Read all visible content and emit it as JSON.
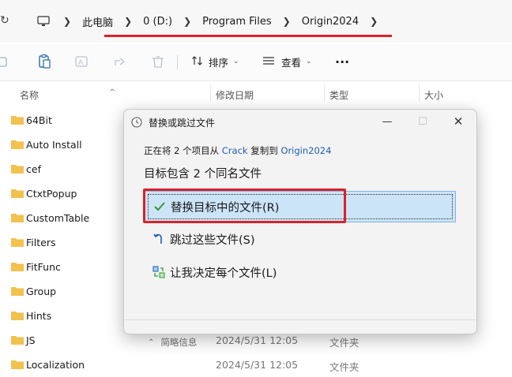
{
  "address_bar": {
    "breadcrumbs": [
      "此电脑",
      "0 (D:)",
      "Program Files",
      "Origin2024"
    ],
    "refresh_icon": "refresh-icon",
    "pc_icon": "computer-icon"
  },
  "toolbar": {
    "sort_label": "排序",
    "view_label": "查看",
    "more_label": "···",
    "icons": [
      "copy-icon",
      "paste-icon",
      "rename-icon",
      "share-icon",
      "delete-icon"
    ]
  },
  "columns": {
    "name": "名称",
    "modified": "修改日期",
    "type": "类型",
    "size": "大小"
  },
  "files": [
    {
      "name": "64Bit",
      "date": "",
      "type": ""
    },
    {
      "name": "Auto Install",
      "date": "",
      "type": ""
    },
    {
      "name": "cef",
      "date": "",
      "type": ""
    },
    {
      "name": "CtxtPopup",
      "date": "",
      "type": ""
    },
    {
      "name": "CustomTable",
      "date": "",
      "type": ""
    },
    {
      "name": "Filters",
      "date": "",
      "type": ""
    },
    {
      "name": "FitFunc",
      "date": "",
      "type": ""
    },
    {
      "name": "Group",
      "date": "",
      "type": ""
    },
    {
      "name": "Hints",
      "date": "",
      "type": ""
    },
    {
      "name": "JS",
      "date": "2024/5/31 12:05",
      "type": "文件夹"
    },
    {
      "name": "Localization",
      "date": "2024/5/31 12:05",
      "type": "文件夹"
    }
  ],
  "dialog": {
    "title": "替换或跳过文件",
    "copy_prefix": "正在将 2 个项目从 ",
    "copy_source": "Crack",
    "copy_middle": " 复制到 ",
    "copy_dest": "Origin2024",
    "heading": "目标包含 2 个同名文件",
    "options": [
      {
        "label": "替换目标中的文件(R)",
        "icon": "checkmark-icon",
        "selected": true
      },
      {
        "label": "跳过这些文件(S)",
        "icon": "skip-arrow-icon",
        "selected": false
      },
      {
        "label": "让我决定每个文件(L)",
        "icon": "decide-icon",
        "selected": false
      }
    ],
    "details_label": "简略信息"
  },
  "colors": {
    "accent_link": "#1e5fb4",
    "highlight": "#cce4f7",
    "annotation_red": "#d9222a",
    "folder": "#f2c14e"
  }
}
